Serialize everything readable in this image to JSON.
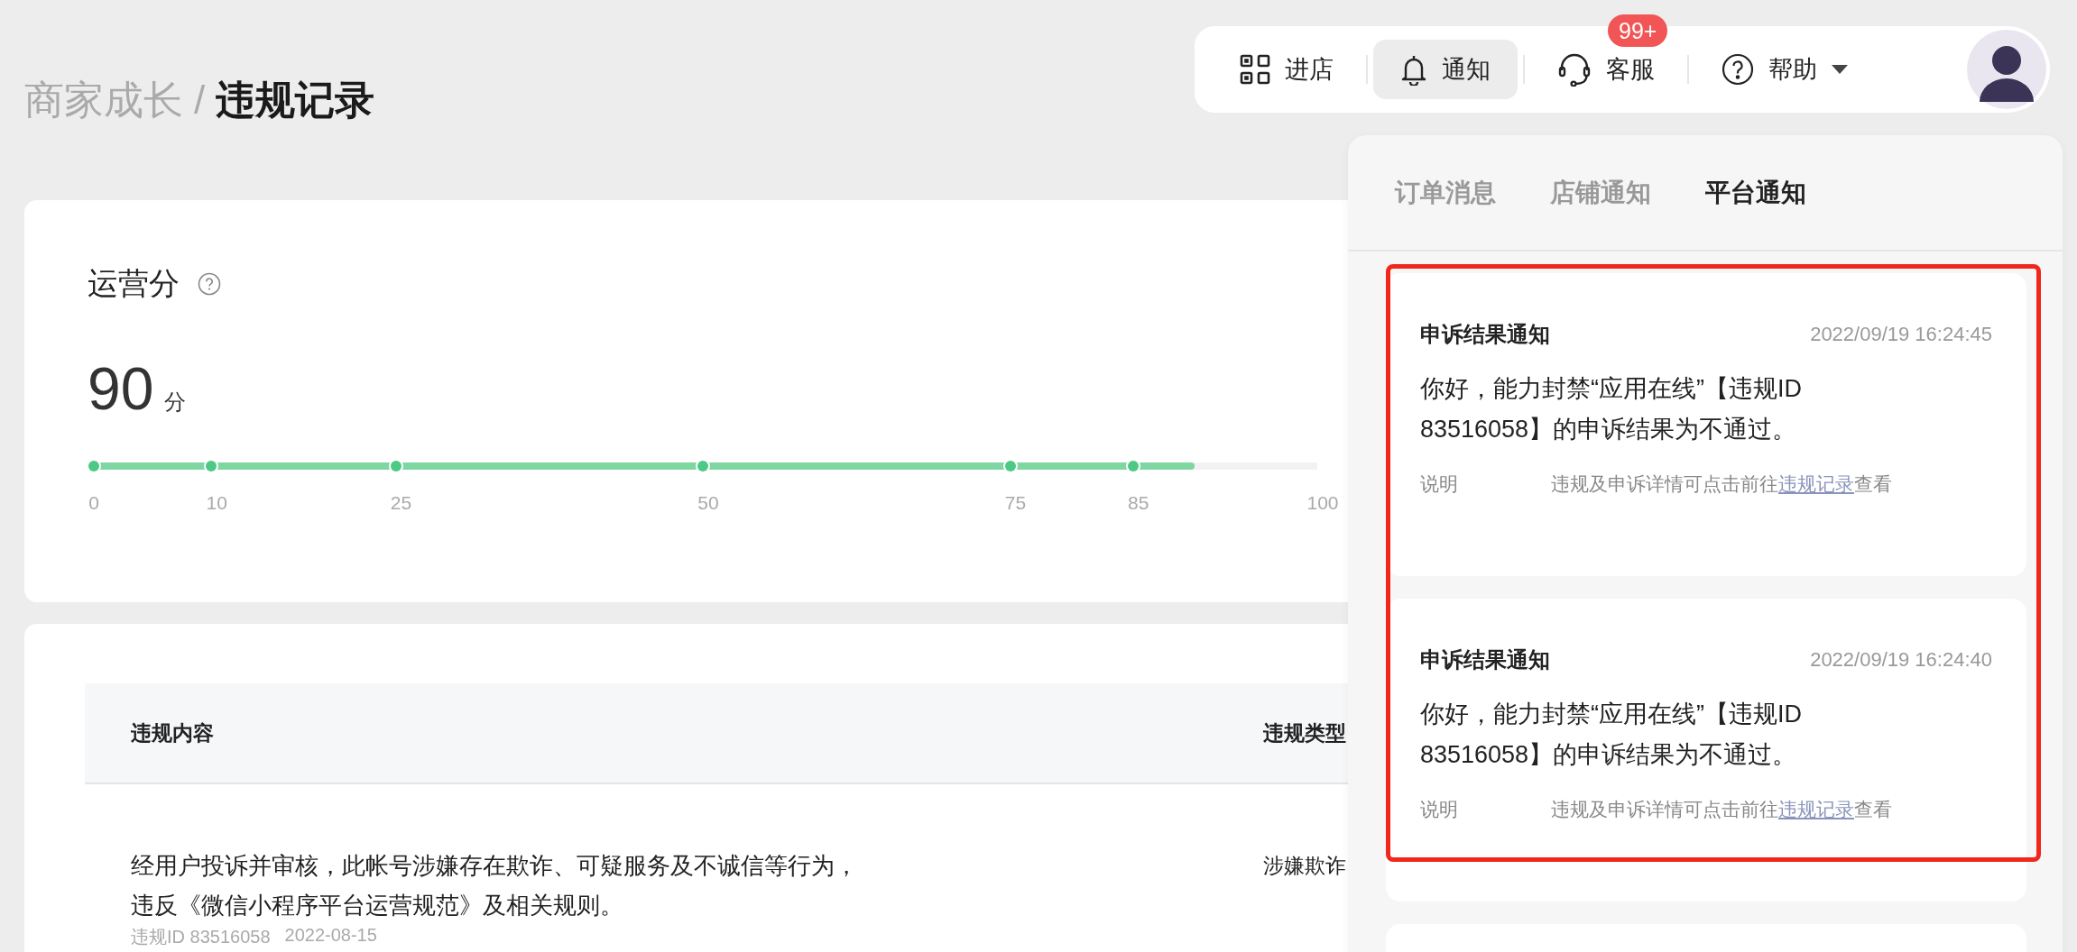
{
  "breadcrumb": {
    "parent": "商家成长",
    "separator": "/",
    "current": "违规记录"
  },
  "topbar": {
    "items": [
      {
        "kind": "qr",
        "label": "进店",
        "selected": false
      },
      {
        "kind": "bell",
        "label": "通知",
        "selected": true
      },
      {
        "kind": "headset",
        "label": "客服",
        "selected": false,
        "badge": "99+"
      },
      {
        "kind": "help",
        "label": "帮助",
        "selected": false,
        "caret": true
      }
    ]
  },
  "score": {
    "title": "运营分",
    "value": "90",
    "unit": "分",
    "level": 0.9,
    "ticks": [
      "0",
      "10",
      "25",
      "50",
      "75",
      "85",
      "100"
    ]
  },
  "table": {
    "columns": [
      "违规内容",
      "违规类型"
    ],
    "rows": [
      {
        "content": "经用户投诉并审核，此帐号涉嫌存在欺诈、可疑服务及不诚信等行为，违反《微信小程序平台运营规范》及相关规则。",
        "type": "涉嫌欺诈",
        "id": "违规ID 83516058",
        "date": "2022-08-15"
      }
    ]
  },
  "notifications": {
    "tabs": [
      {
        "label": "订单消息",
        "selected": false
      },
      {
        "label": "店铺通知",
        "selected": false
      },
      {
        "label": "平台通知",
        "selected": true
      }
    ],
    "items": [
      {
        "title": "申诉结果通知",
        "time": "2022/09/19 16:24:45",
        "body": "你好，能力封禁“应用在线”【违规ID 83516058】的申诉结果为不通过。",
        "note_label": "说明",
        "note_before": "违规及申诉详情可点击前往",
        "note_link": "违规记录",
        "note_after": "查看"
      },
      {
        "title": "申诉结果通知",
        "time": "2022/09/19 16:24:40",
        "body": "你好，能力封禁“应用在线”【违规ID 83516058】的申诉结果为不通过。",
        "note_label": "说明",
        "note_before": "违规及申诉详情可点击前往",
        "note_link": "违规记录",
        "note_after": "查看"
      }
    ]
  }
}
